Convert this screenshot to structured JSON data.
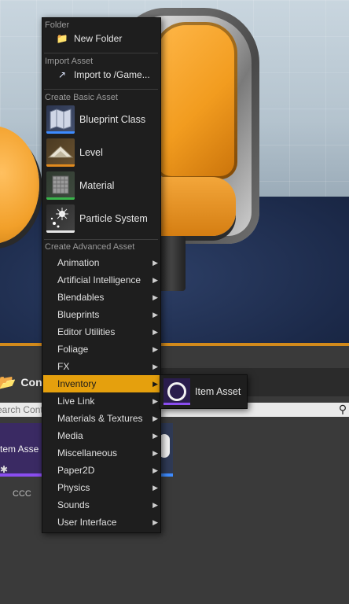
{
  "content_browser": {
    "tab_title": "Cont",
    "search_placeholder": "earch Cont",
    "tile_label": "tem Asse",
    "tile_caption": "CCC"
  },
  "menu": {
    "folder_header": "Folder",
    "new_folder_label": "New Folder",
    "import_header": "Import Asset",
    "import_label": "Import to /Game...",
    "basic_header": "Create Basic Asset",
    "basic": [
      {
        "label": "Blueprint Class",
        "bar_color": "#3d8bff"
      },
      {
        "label": "Level",
        "bar_color": "#e08a1e"
      },
      {
        "label": "Material",
        "bar_color": "#39b54a"
      },
      {
        "label": "Particle System",
        "bar_color": "#e6e6e6"
      }
    ],
    "advanced_header": "Create Advanced Asset",
    "advanced": [
      {
        "label": "Animation"
      },
      {
        "label": "Artificial Intelligence"
      },
      {
        "label": "Blendables"
      },
      {
        "label": "Blueprints"
      },
      {
        "label": "Editor Utilities"
      },
      {
        "label": "Foliage"
      },
      {
        "label": "FX"
      },
      {
        "label": "Inventory",
        "highlighted": true
      },
      {
        "label": "Live Link"
      },
      {
        "label": "Materials & Textures"
      },
      {
        "label": "Media"
      },
      {
        "label": "Miscellaneous"
      },
      {
        "label": "Paper2D"
      },
      {
        "label": "Physics"
      },
      {
        "label": "Sounds"
      },
      {
        "label": "User Interface"
      }
    ]
  },
  "submenu": {
    "item_label": "Item Asset",
    "accent": "#8a4df0"
  },
  "colors": {
    "highlight": "#e5a00d",
    "menu_bg": "#1e1e1e"
  }
}
